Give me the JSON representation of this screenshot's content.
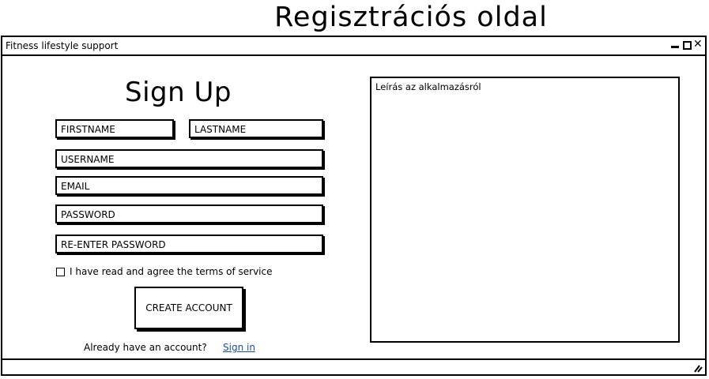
{
  "page_heading": "Regisztrációs oldal",
  "window": {
    "title": "Fitness lifestyle support",
    "controls": {
      "minimize_icon": "minimize-icon",
      "maximize_icon": "maximize-icon",
      "close_icon": "close-icon",
      "close_glyph": "✕"
    }
  },
  "form": {
    "title": "Sign Up",
    "fields": {
      "firstname": "FIRSTNAME",
      "lastname": "LASTNAME",
      "username": "USERNAME",
      "email": "EMAIL",
      "password": "PASSWORD",
      "reenter_password": "RE-ENTER PASSWORD"
    },
    "terms_label": "I have read and agree the terms of service",
    "terms_checked": false,
    "create_button": "CREATE ACCOUNT",
    "already_text": "Already have an account?",
    "signin_link": "Sign in"
  },
  "description_panel": {
    "text": "Leírás az alkalmazásról"
  },
  "colors": {
    "link": "#1a4fa3",
    "border": "#000000",
    "background": "#ffffff"
  }
}
